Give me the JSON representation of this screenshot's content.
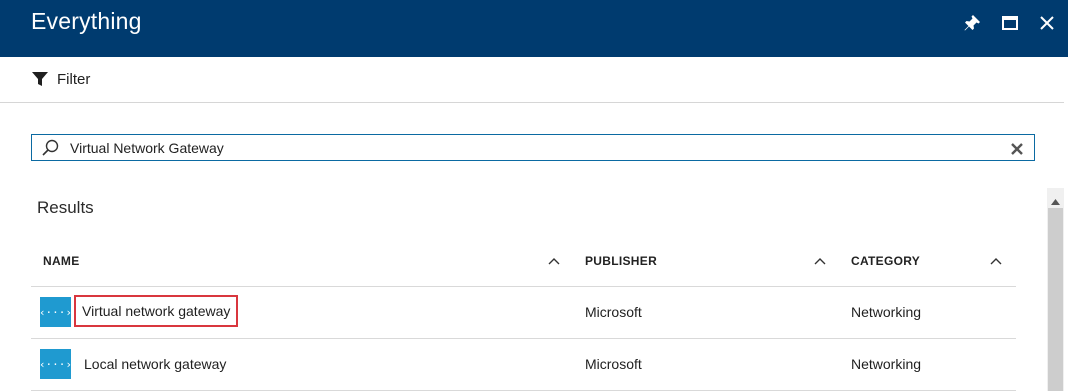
{
  "window": {
    "title": "Everything",
    "buttons": {
      "pin": "pin-icon",
      "maximize": "maximize-icon",
      "close": "close-icon"
    }
  },
  "toolbar": {
    "filter_label": "Filter"
  },
  "search": {
    "value": "Virtual Network Gateway",
    "placeholder": ""
  },
  "results": {
    "label": "Results",
    "columns": [
      "NAME",
      "PUBLISHER",
      "CATEGORY"
    ],
    "rows": [
      {
        "name": "Virtual network gateway",
        "publisher": "Microsoft",
        "category": "Networking",
        "icon": "virtual-network-gateway-icon"
      },
      {
        "name": "Local network gateway",
        "publisher": "Microsoft",
        "category": "Networking",
        "icon": "local-network-gateway-icon"
      }
    ],
    "icon_glyph": "‹···›"
  },
  "colors": {
    "titlebar": "#003b6f",
    "accent": "#0b6aa2",
    "resource_icon": "#1f9ad0",
    "highlight": "#d9363e"
  }
}
